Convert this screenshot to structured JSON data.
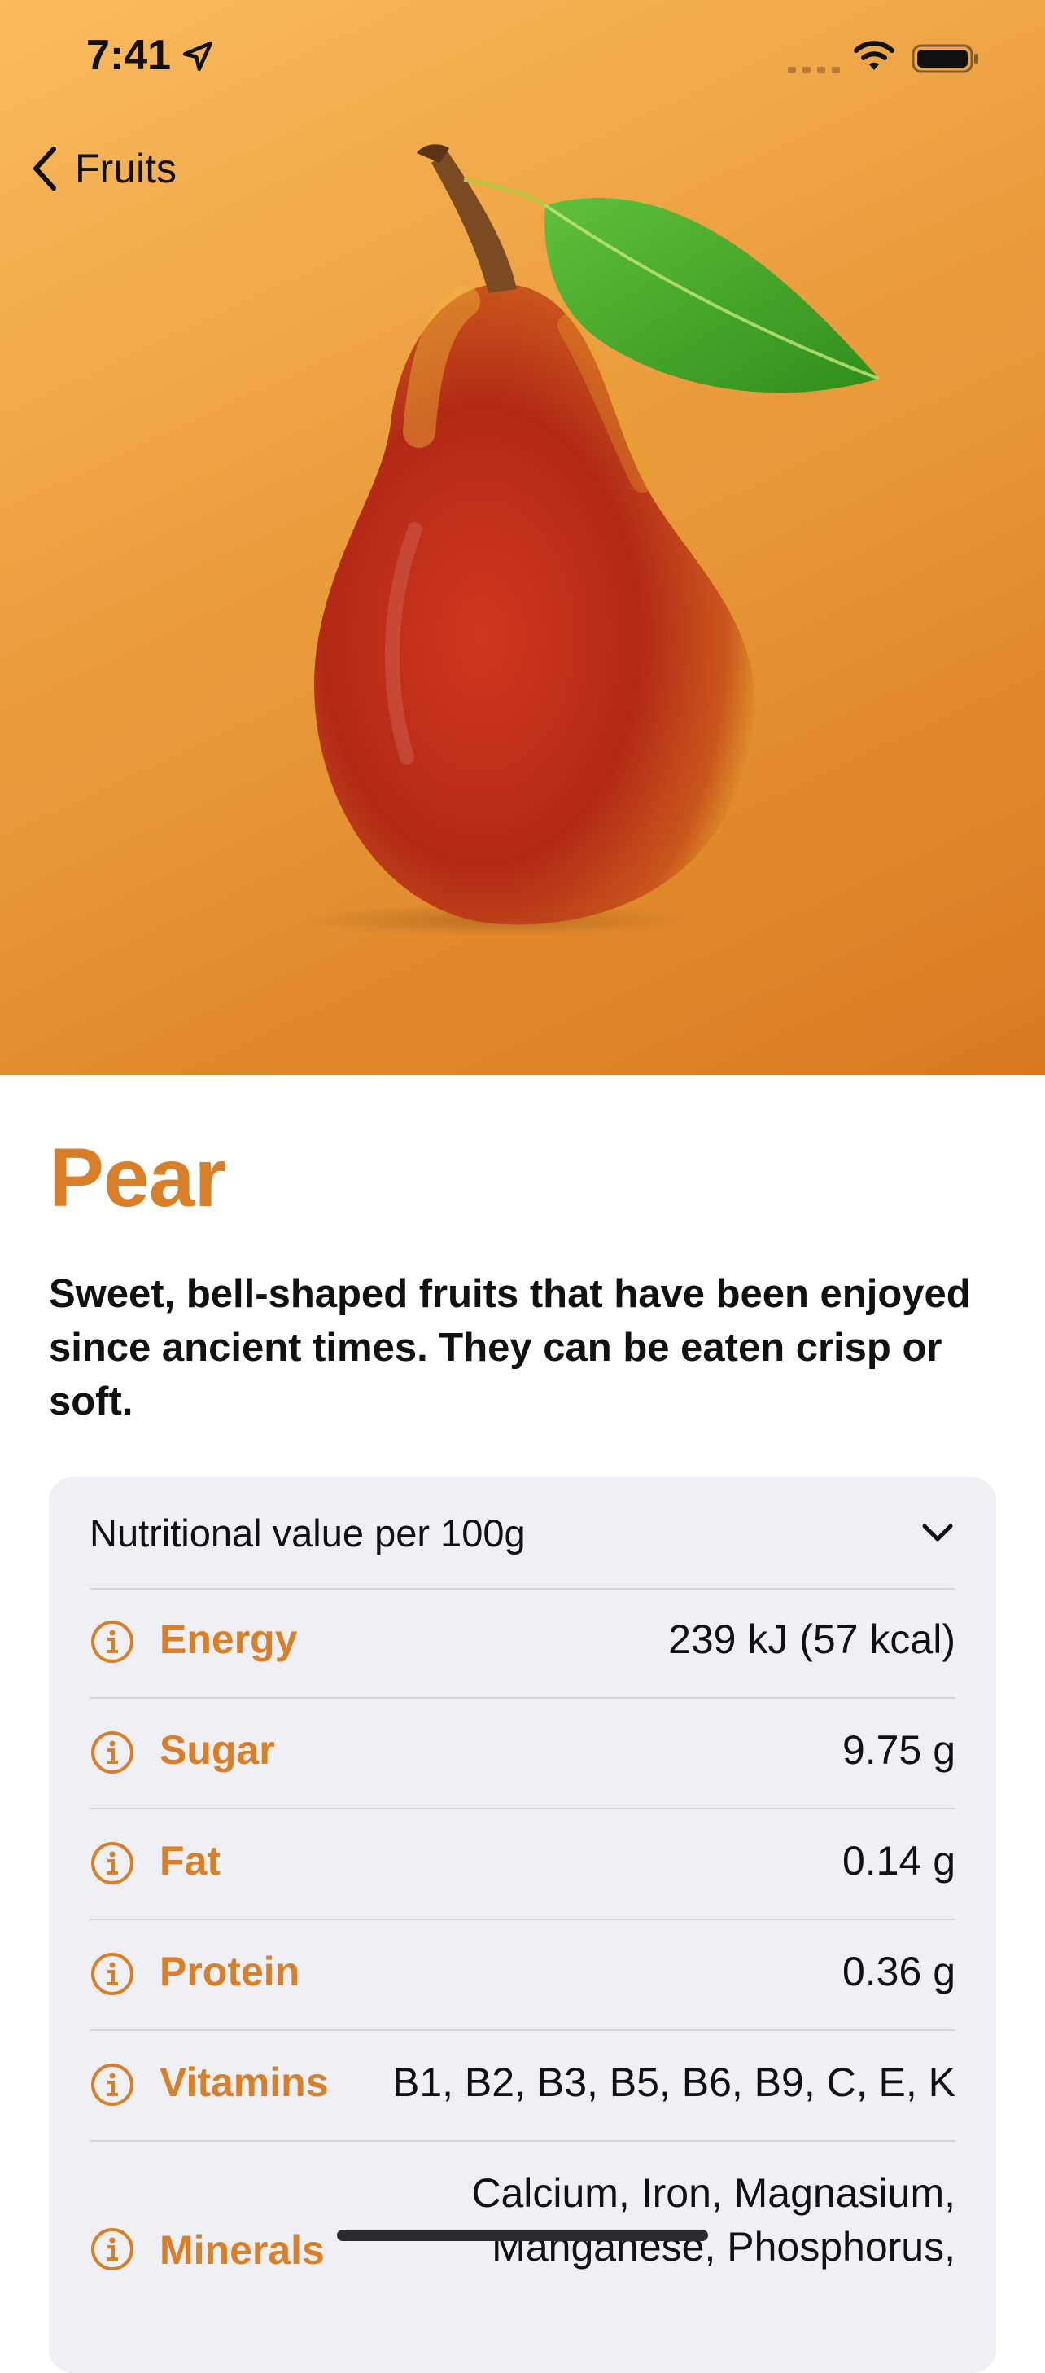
{
  "status": {
    "time": "7:41"
  },
  "nav": {
    "back_label": "Fruits"
  },
  "fruit": {
    "name": "Pear",
    "description": "Sweet, bell-shaped fruits that have been enjoyed since ancient times. They can be eaten crisp or soft."
  },
  "nutrition": {
    "header": "Nutritional value per 100g",
    "rows": [
      {
        "label": "Energy",
        "value": "239 kJ (57 kcal)"
      },
      {
        "label": "Sugar",
        "value": "9.75 g"
      },
      {
        "label": "Fat",
        "value": "0.14 g"
      },
      {
        "label": "Protein",
        "value": "0.36 g"
      },
      {
        "label": "Vitamins",
        "value": "B1, B2, B3, B5, B6, B9, C, E, K"
      },
      {
        "label": "Minerals",
        "value_line1": "Calcium, Iron, Magnasium,",
        "value_line2": "Manganese, Phosphorus,"
      }
    ]
  },
  "colors": {
    "accent": "#d97f27",
    "hero_start": "#f9bb5e",
    "hero_end": "#d97a22",
    "card_bg": "#efeff4"
  },
  "icons": [
    "location-arrow-icon",
    "signal-icon",
    "wifi-icon",
    "battery-icon",
    "chevron-left-icon",
    "chevron-down-icon",
    "info-icon"
  ]
}
